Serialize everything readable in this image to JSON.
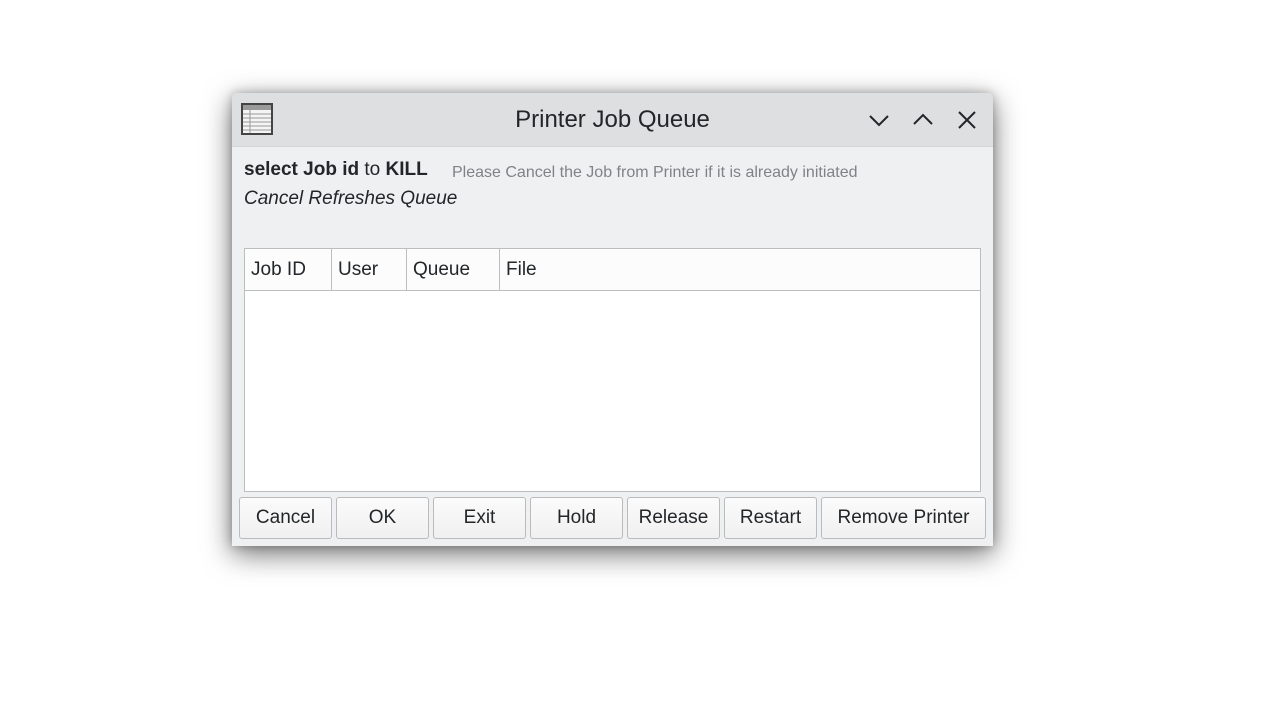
{
  "window": {
    "title": "Printer Job Queue",
    "app_icon": "table-icon",
    "controls": {
      "minimize_icon": "chevron-down-icon",
      "maximize_icon": "chevron-up-icon",
      "close_icon": "close-icon"
    }
  },
  "instructions": {
    "part1": "select Job id",
    "part2": " to ",
    "part3": "KILL",
    "hint": "Please Cancel the Job from Printer if it is already initiated",
    "italic_note": "Cancel Refreshes Queue"
  },
  "table": {
    "columns": [
      "Job ID",
      "User",
      "Queue",
      "File"
    ],
    "rows": []
  },
  "buttons": {
    "cancel": "Cancel",
    "ok": "OK",
    "exit": "Exit",
    "hold": "Hold",
    "release": "Release",
    "restart": "Restart",
    "remove_printer": "Remove Printer"
  },
  "colors": {
    "titlebar": "#dedfe0",
    "window_bg": "#eff0f1",
    "hint_text": "#7f8386"
  }
}
